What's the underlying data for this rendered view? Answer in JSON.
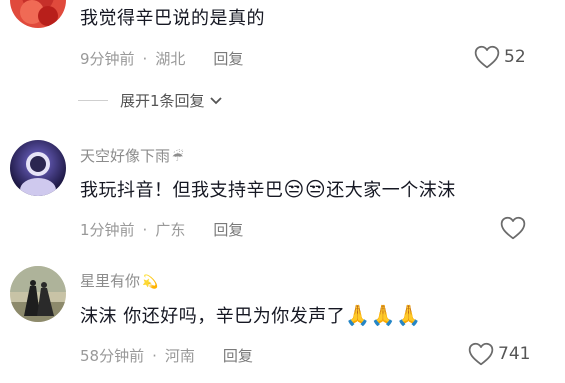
{
  "comments": [
    {
      "content": "我觉得辛巴说的是真的",
      "time": "9分钟前",
      "location": "湖北",
      "reply": "回复",
      "likes": "52"
    },
    {
      "username": "天空好像下雨",
      "username_deco": "☔",
      "content_text": "我玩抖音！但我支持辛巴",
      "emoji1": "😒",
      "emoji2": "😒",
      "content_tail": "还大家一个沫沫",
      "time": "1分钟前",
      "location": "广东",
      "reply": "回复"
    },
    {
      "username": "星里有你",
      "username_deco": "💫",
      "content_text": "沫沫 你还好吗，辛巴为你发声了",
      "emojis": "🙏🙏🙏",
      "time": "58分钟前",
      "location": "河南",
      "reply": "回复",
      "likes": "741"
    }
  ],
  "expand_label": "展开1条回复",
  "separator": "·",
  "colors": {
    "text": "#161823",
    "meta": "#999999"
  },
  "icons": {
    "like": "heart-outline-icon",
    "expand": "chevron-down-icon"
  }
}
